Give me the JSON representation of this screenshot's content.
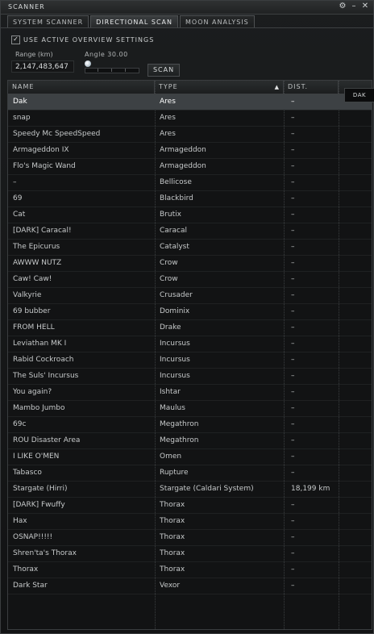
{
  "window": {
    "title": "SCANNER",
    "buttons": [
      "⚙",
      "–",
      "✕"
    ]
  },
  "tabs": [
    "SYSTEM SCANNER",
    "DIRECTIONAL SCAN",
    "MOON ANALYSIS"
  ],
  "active_tab": 1,
  "options": {
    "use_overview_label": "USE ACTIVE OVERVIEW SETTINGS",
    "use_overview_checked": true
  },
  "range": {
    "label": "Range (km)",
    "value": "2,147,483,647"
  },
  "angle": {
    "label": "Angle 30.00",
    "fraction": 0.0
  },
  "scan_button": "SCAN",
  "table": {
    "headers": [
      "NAME",
      "TYPE",
      "DIST."
    ],
    "sort_indicator": "▲",
    "rows": [
      {
        "name": "Dak",
        "type": "Ares",
        "dist": "–"
      },
      {
        "name": "snap",
        "type": "Ares",
        "dist": "–"
      },
      {
        "name": "Speedy Mc SpeedSpeed",
        "type": "Ares",
        "dist": "–"
      },
      {
        "name": "Armageddon IX",
        "type": "Armageddon",
        "dist": "–"
      },
      {
        "name": "Flo's Magic Wand",
        "type": "Armageddon",
        "dist": "–"
      },
      {
        "name": "–",
        "type": "Bellicose",
        "dist": "–"
      },
      {
        "name": "69",
        "type": "Blackbird",
        "dist": "–"
      },
      {
        "name": "Cat",
        "type": "Brutix",
        "dist": "–"
      },
      {
        "name": "[DARK] Caracal!",
        "type": "Caracal",
        "dist": "–"
      },
      {
        "name": "The Epicurus",
        "type": "Catalyst",
        "dist": "–"
      },
      {
        "name": "AWWW NUTZ",
        "type": "Crow",
        "dist": "–"
      },
      {
        "name": "Caw! Caw!",
        "type": "Crow",
        "dist": "–"
      },
      {
        "name": "Valkyrie",
        "type": "Crusader",
        "dist": "–"
      },
      {
        "name": "69 bubber",
        "type": "Dominix",
        "dist": "–"
      },
      {
        "name": "FROM HELL",
        "type": "Drake",
        "dist": "–"
      },
      {
        "name": "Leviathan MK I",
        "type": "Incursus",
        "dist": "–"
      },
      {
        "name": "Rabid Cockroach",
        "type": "Incursus",
        "dist": "–"
      },
      {
        "name": "The Suls' Incursus",
        "type": "Incursus",
        "dist": "–"
      },
      {
        "name": "You again?",
        "type": "Ishtar",
        "dist": "–"
      },
      {
        "name": "Mambo Jumbo",
        "type": "Maulus",
        "dist": "–"
      },
      {
        "name": "69c",
        "type": "Megathron",
        "dist": "–"
      },
      {
        "name": "ROU Disaster Area",
        "type": "Megathron",
        "dist": "–"
      },
      {
        "name": "I LIKE O'MEN",
        "type": "Omen",
        "dist": "–"
      },
      {
        "name": "Tabasco",
        "type": "Rupture",
        "dist": "–"
      },
      {
        "name": "Stargate (Hirri)",
        "type": "Stargate (Caldari System)",
        "dist": "18,199 km"
      },
      {
        "name": "[DARK] Fwuffy",
        "type": "Thorax",
        "dist": "–"
      },
      {
        "name": "Hax",
        "type": "Thorax",
        "dist": "–"
      },
      {
        "name": "OSNAP!!!!!",
        "type": "Thorax",
        "dist": "–"
      },
      {
        "name": "Shren'ta's Thorax",
        "type": "Thorax",
        "dist": "–"
      },
      {
        "name": "Thorax",
        "type": "Thorax",
        "dist": "–"
      },
      {
        "name": "Dark Star",
        "type": "Vexor",
        "dist": "–"
      }
    ],
    "selected_row": 0
  },
  "tooltip": "DAK"
}
